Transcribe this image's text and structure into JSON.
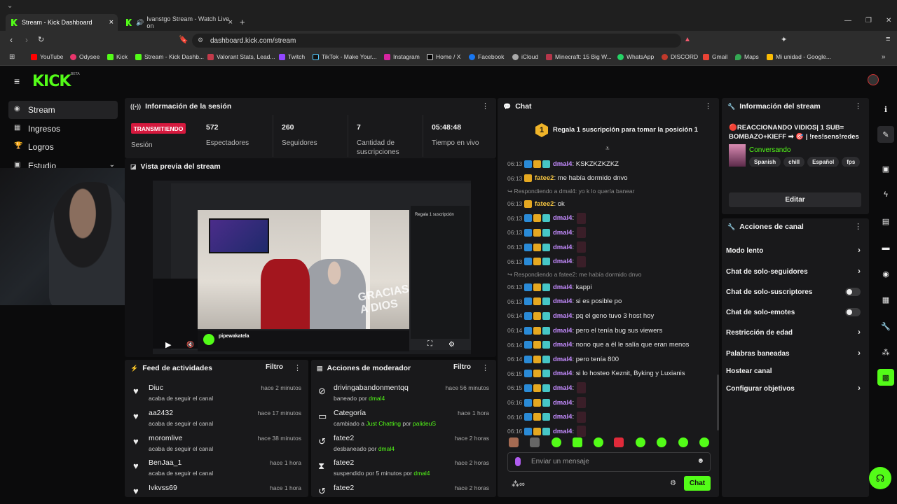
{
  "browser": {
    "tabs": [
      {
        "title": "Stream - Kick Dashboard"
      },
      {
        "title": "Ivanstgo Stream - Watch Live on"
      }
    ],
    "url": "dashboard.kick.com/stream",
    "bookmarks": [
      "YouTube",
      "Odysee",
      "Kick",
      "Stream - Kick Dashb...",
      "Valorant Stats, Lead...",
      "Twitch",
      "TikTok - Make Your...",
      "Instagram",
      "Home / X",
      "Facebook",
      "iCloud",
      "Minecraft: 15 Big W...",
      "WhatsApp",
      "DISCORD",
      "Gmail",
      "Maps",
      "Mi unidad - Google..."
    ]
  },
  "brand": {
    "logo": "KICK",
    "beta": "BETA",
    "accent": "#53fc18"
  },
  "sidebar": {
    "items": [
      {
        "label": "Stream",
        "icon": "broadcast-icon"
      },
      {
        "label": "Ingresos",
        "icon": "bars-icon"
      },
      {
        "label": "Logros",
        "icon": "trophy-icon"
      },
      {
        "label": "Estudio",
        "icon": "studio-icon"
      }
    ]
  },
  "session": {
    "title": "Información de la sesión",
    "status": "TRANSMITIENDO",
    "status_label": "Sesión",
    "stats": [
      {
        "value": "572",
        "label": "Espectadores"
      },
      {
        "value": "260",
        "label": "Seguidores"
      },
      {
        "value": "7",
        "label": "Cantidad de suscripciones"
      },
      {
        "value": "05:48:48",
        "label": "Tiempo en vivo"
      }
    ]
  },
  "preview": {
    "title": "Vista previa del stream",
    "channel": "pipewakatela",
    "overlay_text": "GRACIAS A DIOS",
    "sub_text": "Regala 1 suscripción"
  },
  "activity": {
    "title": "Feed de actividades",
    "filter": "Filtro",
    "items": [
      {
        "name": "Diuc",
        "desc": "acaba de seguir el canal",
        "time": "hace 2 minutos"
      },
      {
        "name": "aa2432",
        "desc": "acaba de seguir el canal",
        "time": "hace 17 minutos"
      },
      {
        "name": "moromlive",
        "desc": "acaba de seguir el canal",
        "time": "hace 38 minutos"
      },
      {
        "name": "BenJaa_1",
        "desc": "acaba de seguir el canal",
        "time": "hace 1 hora"
      },
      {
        "name": "Ivkvss69",
        "desc": "",
        "time": "hace 1 hora"
      }
    ]
  },
  "modactions": {
    "title": "Acciones de moderador",
    "filter": "Filtro",
    "items": [
      {
        "name": "drivingabandonmentqq",
        "pre": "baneado por",
        "by": "dmal4",
        "post": "",
        "time": "hace 56 minutos",
        "icon": "ban-icon"
      },
      {
        "name": "Categoría",
        "pre": "cambiado a",
        "by": "Just Chatting",
        "post": "por",
        "by2": "palideuS",
        "time": "hace 1 hora",
        "icon": "category-icon"
      },
      {
        "name": "fatee2",
        "pre": "desbaneado por",
        "by": "dmal4",
        "post": "",
        "time": "hace 2 horas",
        "icon": "unban-icon"
      },
      {
        "name": "fatee2",
        "pre": "suspendido por 5 minutos por",
        "by": "dmal4",
        "post": "",
        "time": "hace 2 horas",
        "icon": "hourglass-icon"
      },
      {
        "name": "fatee2",
        "pre": "",
        "by": "",
        "post": "",
        "time": "hace 2 horas",
        "icon": "unban-icon"
      }
    ]
  },
  "chat": {
    "title": "Chat",
    "pinned": "Regala 1 suscripción para tomar la posición 1",
    "pinned_rank": "1",
    "input_placeholder": "Enviar un mensaje",
    "send": "Chat",
    "messages": [
      {
        "time": "06:13",
        "user": "dmal4",
        "text": ": KSKZKZKZKZ"
      },
      {
        "time": "06:13",
        "user": "fatee2",
        "text": ": me había dormido dnvo"
      },
      {
        "reply": "Respondiendo a dmal4: yo k lo quería banear"
      },
      {
        "time": "06:13",
        "user": "fatee2",
        "text": ": ok"
      },
      {
        "time": "06:13",
        "user": "dmal4",
        "text": ":"
      },
      {
        "time": "06:13",
        "user": "dmal4",
        "text": ":"
      },
      {
        "time": "06:13",
        "user": "dmal4",
        "text": ":"
      },
      {
        "time": "06:13",
        "user": "dmal4",
        "text": ":"
      },
      {
        "reply": "Respondiendo a fatee2: me había dormido dnvo"
      },
      {
        "time": "06:13",
        "user": "dmal4",
        "text": ": kappi"
      },
      {
        "time": "06:13",
        "user": "dmal4",
        "text": ": si es posible po"
      },
      {
        "time": "06:14",
        "user": "dmal4",
        "text": ": pq el geno tuvo 3 host hoy"
      },
      {
        "time": "06:14",
        "user": "dmal4",
        "text": ": pero el tenía bug sus viewers"
      },
      {
        "time": "06:14",
        "user": "dmal4",
        "text": ": nono que a él le salía que eran menos"
      },
      {
        "time": "06:14",
        "user": "dmal4",
        "text": ": pero tenía 800"
      },
      {
        "time": "06:15",
        "user": "dmal4",
        "text": ": si lo hosteo Keznit, Byking y Luxianis"
      },
      {
        "time": "06:15",
        "user": "dmal4",
        "text": ":"
      },
      {
        "time": "06:16",
        "user": "dmal4",
        "text": ":"
      },
      {
        "time": "06:16",
        "user": "dmal4",
        "text": ":"
      },
      {
        "time": "06:16",
        "user": "dmal4",
        "text": ":"
      }
    ]
  },
  "streaminfo": {
    "title": "Información del stream",
    "stream_title": "🔴REACCIONANDO VIDIOS| 1 SUB= BOMBAZO+KIEFF ➡ 🎯 | !res!sens!redes",
    "category": "Conversando",
    "tags": [
      "Spanish",
      "chill",
      "Español",
      "fps"
    ],
    "edit": "Editar"
  },
  "channelactions": {
    "title": "Acciones de canal",
    "items": [
      {
        "label": "Modo lento",
        "control": "chevron"
      },
      {
        "label": "Chat de solo-seguidores",
        "control": "chevron"
      },
      {
        "label": "Chat de solo-suscriptores",
        "control": "toggle"
      },
      {
        "label": "Chat de solo-emotes",
        "control": "toggle"
      },
      {
        "label": "Restricción de edad",
        "control": "chevron"
      },
      {
        "label": "Palabras baneadas",
        "control": "chevron"
      },
      {
        "label": "Hostear canal",
        "control": "none"
      },
      {
        "label": "Configurar objetivos",
        "control": "chevron"
      }
    ]
  }
}
